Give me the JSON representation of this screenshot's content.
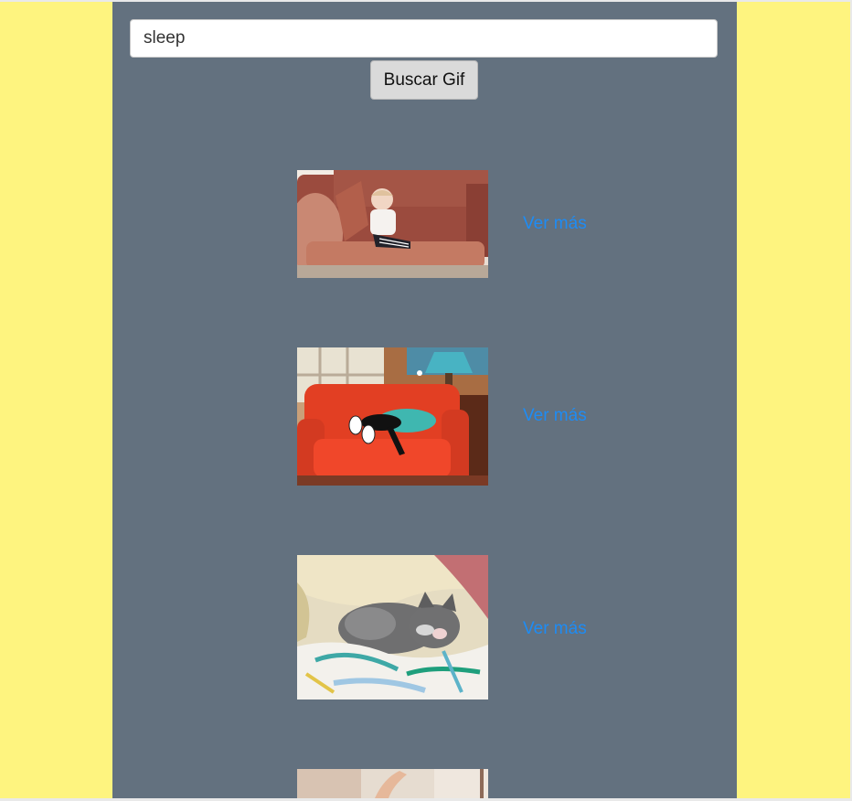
{
  "search": {
    "value": "sleep",
    "placeholder": ""
  },
  "search_button": {
    "label": "Buscar Gif"
  },
  "results": [
    {
      "link_label": "Ver más",
      "image_icon": "gif-baby-on-sofa-image"
    },
    {
      "link_label": "Ver más",
      "image_icon": "gif-cartoon-cat-sleeping-image"
    },
    {
      "link_label": "Ver más",
      "image_icon": "gif-kitten-sleeping-image"
    },
    {
      "link_label": "",
      "image_icon": "gif-hand-image"
    }
  ],
  "colors": {
    "page_background": "#fef47f",
    "panel_background": "#63717f",
    "link": "#1d8cf5"
  }
}
